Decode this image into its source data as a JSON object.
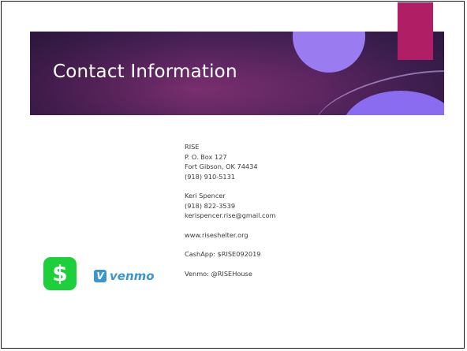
{
  "slide": {
    "title": "Contact Information",
    "org": {
      "name": "RISE",
      "address_line1": "P. O. Box 127",
      "address_line2": "Fort Gibson, OK 74434",
      "phone": "(918) 910-5131"
    },
    "contact_person": {
      "name": "Keri Spencer",
      "phone": "(918) 822-3539",
      "email": "kerispencer.rise@gmail.com"
    },
    "website": "www.riseshelter.org",
    "cashapp_line": "CashApp:  $RISE092019",
    "venmo_line": "Venmo:  @RISEHouse",
    "logos": {
      "cashapp_glyph": "$",
      "venmo_badge": "V",
      "venmo_word": "venmo"
    },
    "colors": {
      "banner_dark": "#3d1f4f",
      "banner_mid": "#7a2f6e",
      "accent_magenta": "#b01e66",
      "accent_lavender": "#9a7cf0",
      "cashapp_green": "#1dcf3a",
      "venmo_blue": "#3d95ce"
    }
  }
}
